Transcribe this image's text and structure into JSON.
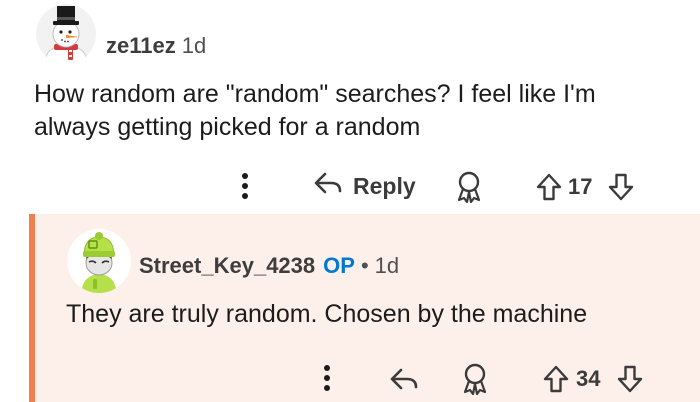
{
  "comment": {
    "author": "ze11ez",
    "age": "1d",
    "body": "How random are \"random\" searches? I feel like I'm always getting picked for a random",
    "actions": {
      "reply_label": "Reply",
      "score": "17"
    }
  },
  "reply": {
    "author": "Street_Key_4238",
    "op_badge": "OP",
    "separator": "•",
    "age": "1d",
    "body": "They are truly random. Chosen by the machine",
    "actions": {
      "score": "34"
    }
  },
  "colors": {
    "reply_background": "#fdf0ea",
    "thread_line": "#f08050",
    "op_badge": "#0079d3",
    "text": "#1c1c1c",
    "icon": "#3b3b3b"
  },
  "icons": [
    "snowman-avatar",
    "green-hat-avatar",
    "more-options-icon",
    "reply-arrow-icon",
    "award-icon",
    "upvote-icon",
    "downvote-icon"
  ]
}
